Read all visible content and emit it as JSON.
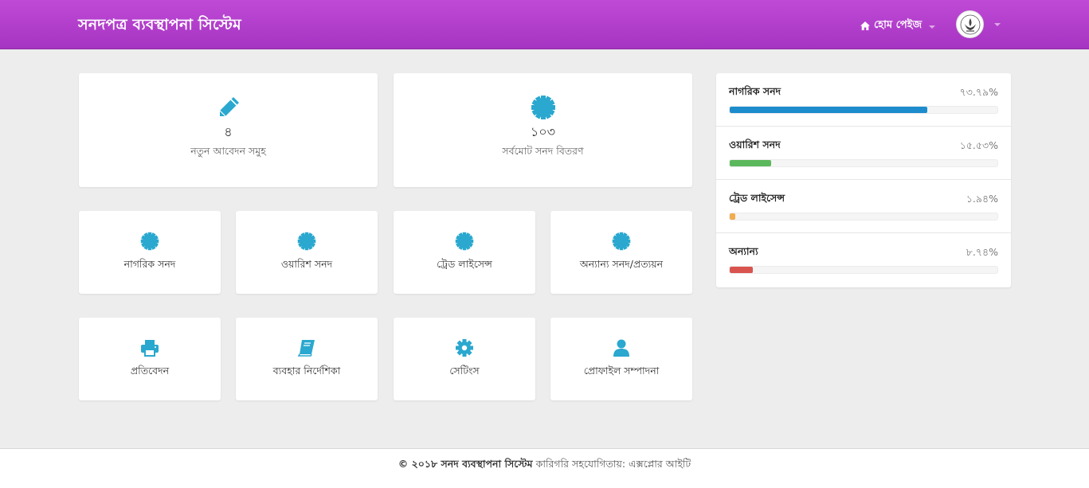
{
  "header": {
    "brand": "সনদপত্র ব্যবস্থাপনা সিস্টেম",
    "home_label": "হোম পেইজ"
  },
  "stats": [
    {
      "value": "৪",
      "label": "নতুন আবেদন সমুহ",
      "icon": "pencil-icon"
    },
    {
      "value": "১০৩",
      "label": "সর্বমোট সনদ বিতরণ",
      "icon": "certificate-icon"
    }
  ],
  "certificate_tiles": [
    {
      "label": "নাগরিক সনদ",
      "icon": "certificate-icon"
    },
    {
      "label": "ওয়ারিশ সনদ",
      "icon": "certificate-icon"
    },
    {
      "label": "ট্রেড লাইসেন্স",
      "icon": "certificate-icon"
    },
    {
      "label": "অন্যান্য সনদ/প্রত্যয়ন",
      "icon": "certificate-icon"
    }
  ],
  "tool_tiles": [
    {
      "label": "প্রতিবেদন",
      "icon": "print-icon"
    },
    {
      "label": "ব্যবহার নির্দেশিকা",
      "icon": "book-icon"
    },
    {
      "label": "সেটিংস",
      "icon": "gear-icon"
    },
    {
      "label": "প্রোফাইল সম্পাদনা",
      "icon": "user-icon"
    }
  ],
  "progress": [
    {
      "name": "নাগরিক সনদ",
      "pct_label": "৭৩.৭৯%",
      "value": 73.79,
      "color": "#1d8ccd"
    },
    {
      "name": "ওয়ারিশ সনদ",
      "pct_label": "১৫.৫৩%",
      "value": 15.53,
      "color": "#5cb85c"
    },
    {
      "name": "ট্রেড লাইসেন্স",
      "pct_label": "১.৯৪%",
      "value": 1.94,
      "color": "#f0ad4e"
    },
    {
      "name": "অন্যান্য",
      "pct_label": "৮.৭৪%",
      "value": 8.74,
      "color": "#d9534f"
    }
  ],
  "footer": {
    "copyright": "© ২০১৮ সনদ ব্যবস্থাপনা সিস্টেম",
    "credit": "কারিগরি সহযোগিতায়: এক্সপ্লোর আইটি"
  },
  "colors": {
    "header": "#b23fcc",
    "accent_icon": "#2aa8cf"
  }
}
